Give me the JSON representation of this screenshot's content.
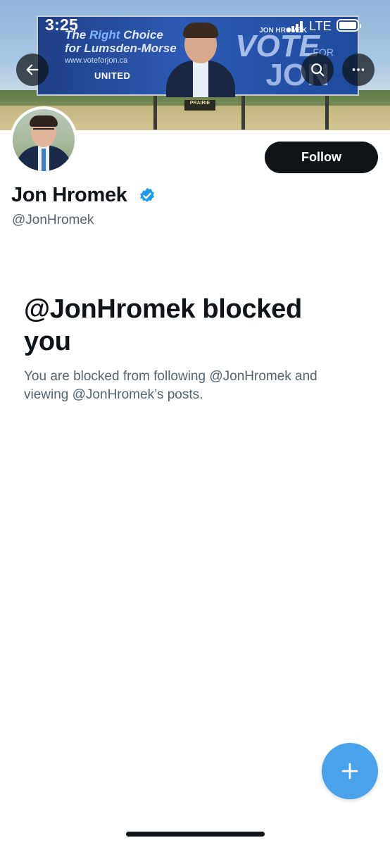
{
  "status_bar": {
    "time": "3:25",
    "network": "LTE"
  },
  "banner": {
    "billboard": {
      "line1_prefix": "The ",
      "line1_highlight": "Right",
      "line1_suffix": " Choice",
      "line2": "for Lumsden-Morse",
      "url": "www.voteforjon.ca",
      "party_logo": "UNITED",
      "name": "JON HROMEK",
      "vote": "VOTE",
      "for": "FOR",
      "jon": "JON",
      "prairie_sign": "PRAIRIE"
    },
    "back_icon": "arrow-left-icon",
    "search_icon": "search-icon",
    "more_icon": "more-horizontal-icon"
  },
  "profile": {
    "display_name": "Jon Hromek",
    "handle": "@JonHromek",
    "verified": true,
    "follow_label": "Follow"
  },
  "blocked": {
    "title": "@JonHromek blocked you",
    "description": "You are blocked from following @JonHromek and viewing @JonHromek’s posts."
  },
  "fab": {
    "icon": "plus-icon"
  },
  "colors": {
    "accent": "#4aa3ea",
    "verified": "#1d9bf0",
    "text": "#0f1419",
    "secondary_text": "#536471"
  }
}
